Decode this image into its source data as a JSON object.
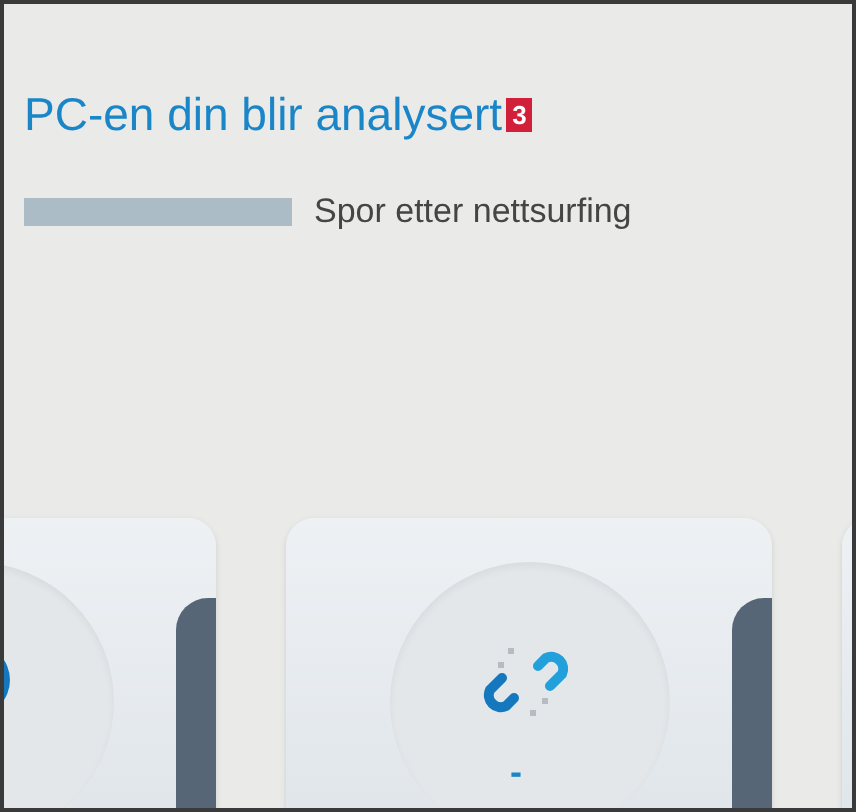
{
  "title": "PC-en din blir analysert",
  "badge": "3",
  "progress": {
    "label": "Spor etter nettsurfing"
  },
  "cards": [
    {
      "kind": "circle-icon"
    },
    {
      "kind": "broken-link",
      "value": "-"
    },
    {
      "kind": "empty"
    }
  ]
}
